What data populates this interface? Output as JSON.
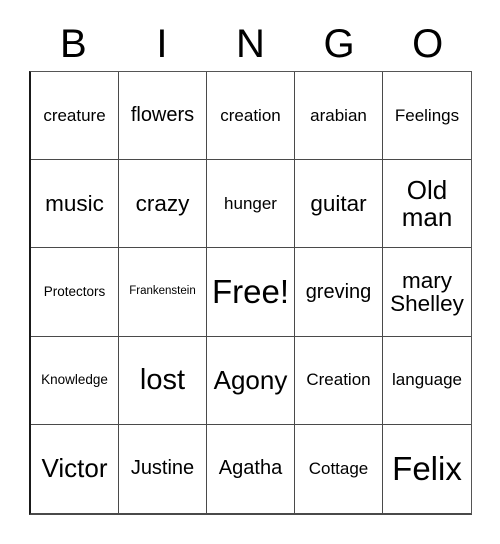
{
  "card": {
    "title_letters": [
      "B",
      "I",
      "N",
      "G",
      "O"
    ],
    "columns": 5,
    "rows": 5,
    "border_color": "#4a4a4a",
    "background_color": "#ffffff",
    "text_color": "#000000",
    "cells": [
      {
        "text": "creature",
        "size": "md"
      },
      {
        "text": "flowers",
        "size": "lg"
      },
      {
        "text": "creation",
        "size": "md"
      },
      {
        "text": "arabian",
        "size": "md"
      },
      {
        "text": "Feelings",
        "size": "md"
      },
      {
        "text": "music",
        "size": "xl"
      },
      {
        "text": "crazy",
        "size": "xl"
      },
      {
        "text": "hunger",
        "size": "md"
      },
      {
        "text": "guitar",
        "size": "xl"
      },
      {
        "text": "Old man",
        "size": "2xl"
      },
      {
        "text": "Protectors",
        "size": "sm"
      },
      {
        "text": "Frankenstein",
        "size": "xs"
      },
      {
        "text": "Free!",
        "size": "4xl"
      },
      {
        "text": "greving",
        "size": "lg"
      },
      {
        "text": "mary Shelley",
        "size": "xl"
      },
      {
        "text": "Knowledge",
        "size": "sm"
      },
      {
        "text": "lost",
        "size": "3xl"
      },
      {
        "text": "Agony",
        "size": "2xl"
      },
      {
        "text": "Creation",
        "size": "md"
      },
      {
        "text": "language",
        "size": "md"
      },
      {
        "text": "Victor",
        "size": "2xl"
      },
      {
        "text": "Justine",
        "size": "lg"
      },
      {
        "text": "Agatha",
        "size": "lg"
      },
      {
        "text": "Cottage",
        "size": "md"
      },
      {
        "text": "Felix",
        "size": "4xl"
      }
    ]
  }
}
